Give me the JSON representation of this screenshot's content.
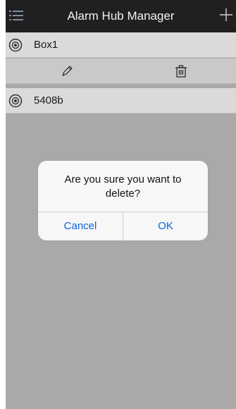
{
  "nav": {
    "title": "Alarm Hub Manager",
    "menu_icon": "list-menu-icon",
    "add_icon": "plus-icon"
  },
  "devices": [
    {
      "name": "Box1",
      "icon": "camera-lens-icon"
    },
    {
      "name": "5408b",
      "icon": "camera-lens-icon"
    }
  ],
  "actions": {
    "edit_icon": "pencil-icon",
    "delete_icon": "trash-icon"
  },
  "dialog": {
    "message": "Are you sure you want to delete?",
    "cancel_label": "Cancel",
    "ok_label": "OK"
  },
  "colors": {
    "navbar": "#202020",
    "row": "#dadada",
    "dim_background": "#a9a9a9",
    "button_text": "#0a63d9"
  }
}
